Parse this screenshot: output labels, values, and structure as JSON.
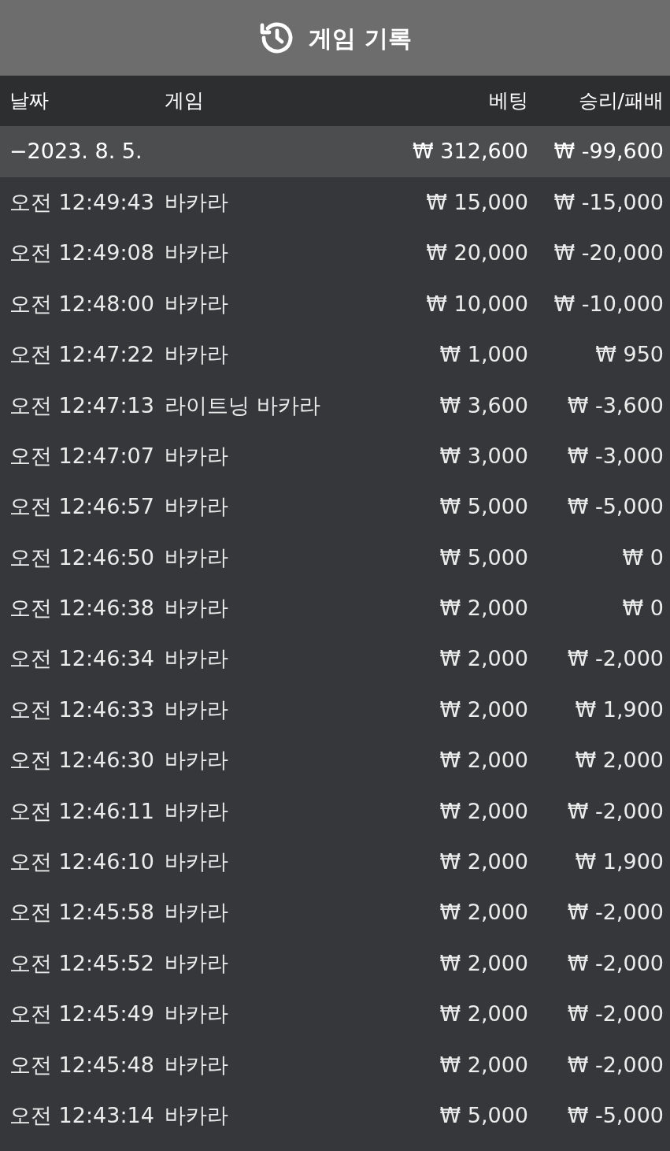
{
  "header": {
    "title": "게임 기록"
  },
  "columns": [
    "날짜",
    "게임",
    "베팅",
    "승리/패배"
  ],
  "group": {
    "date": "−2023. 8. 5.",
    "bet": "₩ 312,600",
    "result": "₩ -99,600"
  },
  "rows": [
    {
      "time": "오전 12:49:43",
      "game": "바카라",
      "bet": "₩ 15,000",
      "result": "₩ -15,000"
    },
    {
      "time": "오전 12:49:08",
      "game": "바카라",
      "bet": "₩ 20,000",
      "result": "₩ -20,000"
    },
    {
      "time": "오전 12:48:00",
      "game": "바카라",
      "bet": "₩ 10,000",
      "result": "₩ -10,000"
    },
    {
      "time": "오전 12:47:22",
      "game": "바카라",
      "bet": "₩ 1,000",
      "result": "₩ 950"
    },
    {
      "time": "오전 12:47:13",
      "game": "라이트닝 바카라",
      "bet": "₩ 3,600",
      "result": "₩ -3,600"
    },
    {
      "time": "오전 12:47:07",
      "game": "바카라",
      "bet": "₩ 3,000",
      "result": "₩ -3,000"
    },
    {
      "time": "오전 12:46:57",
      "game": "바카라",
      "bet": "₩ 5,000",
      "result": "₩ -5,000"
    },
    {
      "time": "오전 12:46:50",
      "game": "바카라",
      "bet": "₩ 5,000",
      "result": "₩ 0"
    },
    {
      "time": "오전 12:46:38",
      "game": "바카라",
      "bet": "₩ 2,000",
      "result": "₩ 0"
    },
    {
      "time": "오전 12:46:34",
      "game": "바카라",
      "bet": "₩ 2,000",
      "result": "₩ -2,000"
    },
    {
      "time": "오전 12:46:33",
      "game": "바카라",
      "bet": "₩ 2,000",
      "result": "₩ 1,900"
    },
    {
      "time": "오전 12:46:30",
      "game": "바카라",
      "bet": "₩ 2,000",
      "result": "₩ 2,000"
    },
    {
      "time": "오전 12:46:11",
      "game": "바카라",
      "bet": "₩ 2,000",
      "result": "₩ -2,000"
    },
    {
      "time": "오전 12:46:10",
      "game": "바카라",
      "bet": "₩ 2,000",
      "result": "₩ 1,900"
    },
    {
      "time": "오전 12:45:58",
      "game": "바카라",
      "bet": "₩ 2,000",
      "result": "₩ -2,000"
    },
    {
      "time": "오전 12:45:52",
      "game": "바카라",
      "bet": "₩ 2,000",
      "result": "₩ -2,000"
    },
    {
      "time": "오전 12:45:49",
      "game": "바카라",
      "bet": "₩ 2,000",
      "result": "₩ -2,000"
    },
    {
      "time": "오전 12:45:48",
      "game": "바카라",
      "bet": "₩ 2,000",
      "result": "₩ -2,000"
    },
    {
      "time": "오전 12:43:14",
      "game": "바카라",
      "bet": "₩ 5,000",
      "result": "₩ -5,000"
    }
  ]
}
